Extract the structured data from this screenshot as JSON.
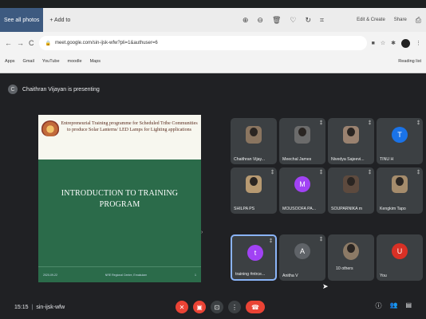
{
  "viewer": {
    "see_all": "See all photos",
    "add_to": "+ Add to",
    "edit_create": "Edit & Create",
    "share": "Share"
  },
  "browser": {
    "url": "meet.google.com/sin-ijsk-wfw?pli=1&authuser=6",
    "bookmarks": [
      "Apps",
      "Gmail",
      "YouTube",
      "moodle",
      "Maps"
    ],
    "reading_list": "Reading list"
  },
  "meet": {
    "presenter_text": "Chaithran Vijayan is presenting",
    "meeting_code": "sin-ijsk-wfw",
    "time": "15:15"
  },
  "slide": {
    "title": "Entrepreneurial Training programme for Scheduled Tribe Communities to produce Solar Lanterns/ LED Lamps for Lighting applications",
    "main_line1": "INTRODUCTION TO TRAINING",
    "main_line2": "PROGRAM",
    "footer_left": "2020-09-22",
    "footer_center": "NRE Regional Centre, Ernakulam",
    "footer_right": "1"
  },
  "participants": [
    {
      "name": "Chaithran Vijay...",
      "kind": "camera"
    },
    {
      "name": "Meechal James",
      "kind": "camera"
    },
    {
      "name": "Nivedya Sajeevi...",
      "kind": "camera"
    },
    {
      "name": "TINU H",
      "kind": "initial",
      "initial": "T",
      "color": "#1a73e8"
    },
    {
      "name": "SHILPA PS",
      "kind": "camera"
    },
    {
      "name": "MOUSOOFA PA...",
      "kind": "initial",
      "initial": "M",
      "color": "#a142f4"
    },
    {
      "name": "SOUPARNIKA m",
      "kind": "camera"
    },
    {
      "name": "Kengkim Tapo",
      "kind": "camera"
    },
    {
      "name": "training #ntrce...",
      "kind": "initial",
      "initial": "t",
      "color": "#a142f4"
    },
    {
      "name": "Anitha V",
      "kind": "initial",
      "initial": "A",
      "color": "#5f6368"
    },
    {
      "name": "10 others",
      "kind": "group"
    },
    {
      "name": "You",
      "kind": "initial",
      "initial": "U",
      "color": "#d93025"
    }
  ],
  "colors": {
    "meet_bg": "#202124",
    "slide_green": "#2b6b4a",
    "hangup": "#ea4335",
    "active_border": "#8ab4f8"
  }
}
